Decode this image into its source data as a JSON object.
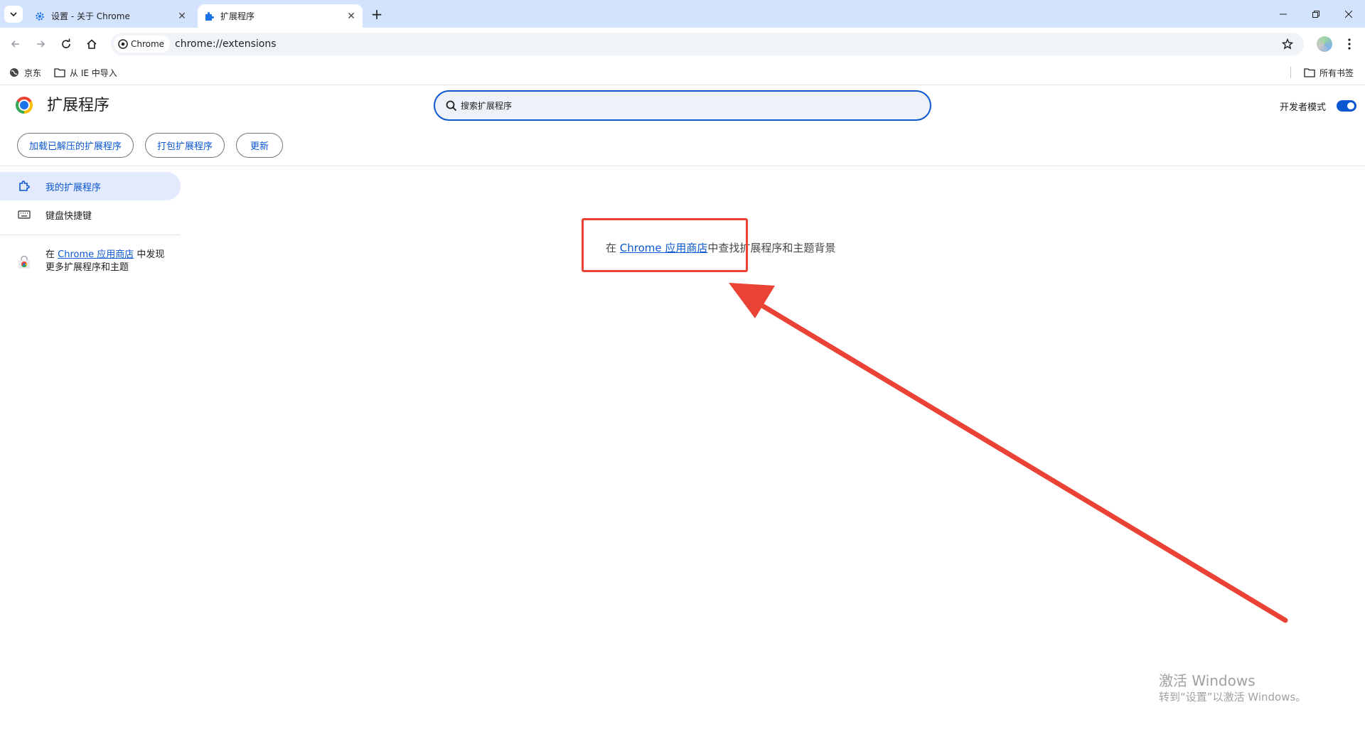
{
  "tabs": [
    {
      "title": "设置 - 关于 Chrome",
      "icon": "gear-icon"
    },
    {
      "title": "扩展程序",
      "icon": "puzzle-icon"
    }
  ],
  "toolbar": {
    "chip_label": "Chrome",
    "url": "chrome://extensions"
  },
  "bookmarks": {
    "items": [
      {
        "label": "京东",
        "icon": "globe-icon"
      },
      {
        "label": "从 IE 中导入",
        "icon": "folder-icon"
      }
    ],
    "all_label": "所有书签"
  },
  "header": {
    "title": "扩展程序",
    "search_placeholder": "搜索扩展程序",
    "dev_mode_label": "开发者模式",
    "dev_mode_on": true,
    "buttons": [
      "加载已解压的扩展程序",
      "打包扩展程序",
      "更新"
    ]
  },
  "sidebar": {
    "items": [
      {
        "label": "我的扩展程序",
        "icon": "extension-icon",
        "selected": true
      },
      {
        "label": "键盘快捷键",
        "icon": "keyboard-icon",
        "selected": false
      }
    ],
    "promo": {
      "prefix": "在 ",
      "link": "Chrome 应用商店",
      "suffix": " 中发现更多扩展程序和主题"
    }
  },
  "main": {
    "prefix": "在 ",
    "link": "Chrome 应用商店",
    "suffix": "中查找扩展程序和主题背景"
  },
  "watermark": {
    "title": "激活 Windows",
    "subtitle": "转到“设置”以激活 Windows。"
  },
  "colors": {
    "accent": "#0b57d0",
    "tabstrip": "#d3e3fd",
    "annotation": "#ea4335"
  }
}
